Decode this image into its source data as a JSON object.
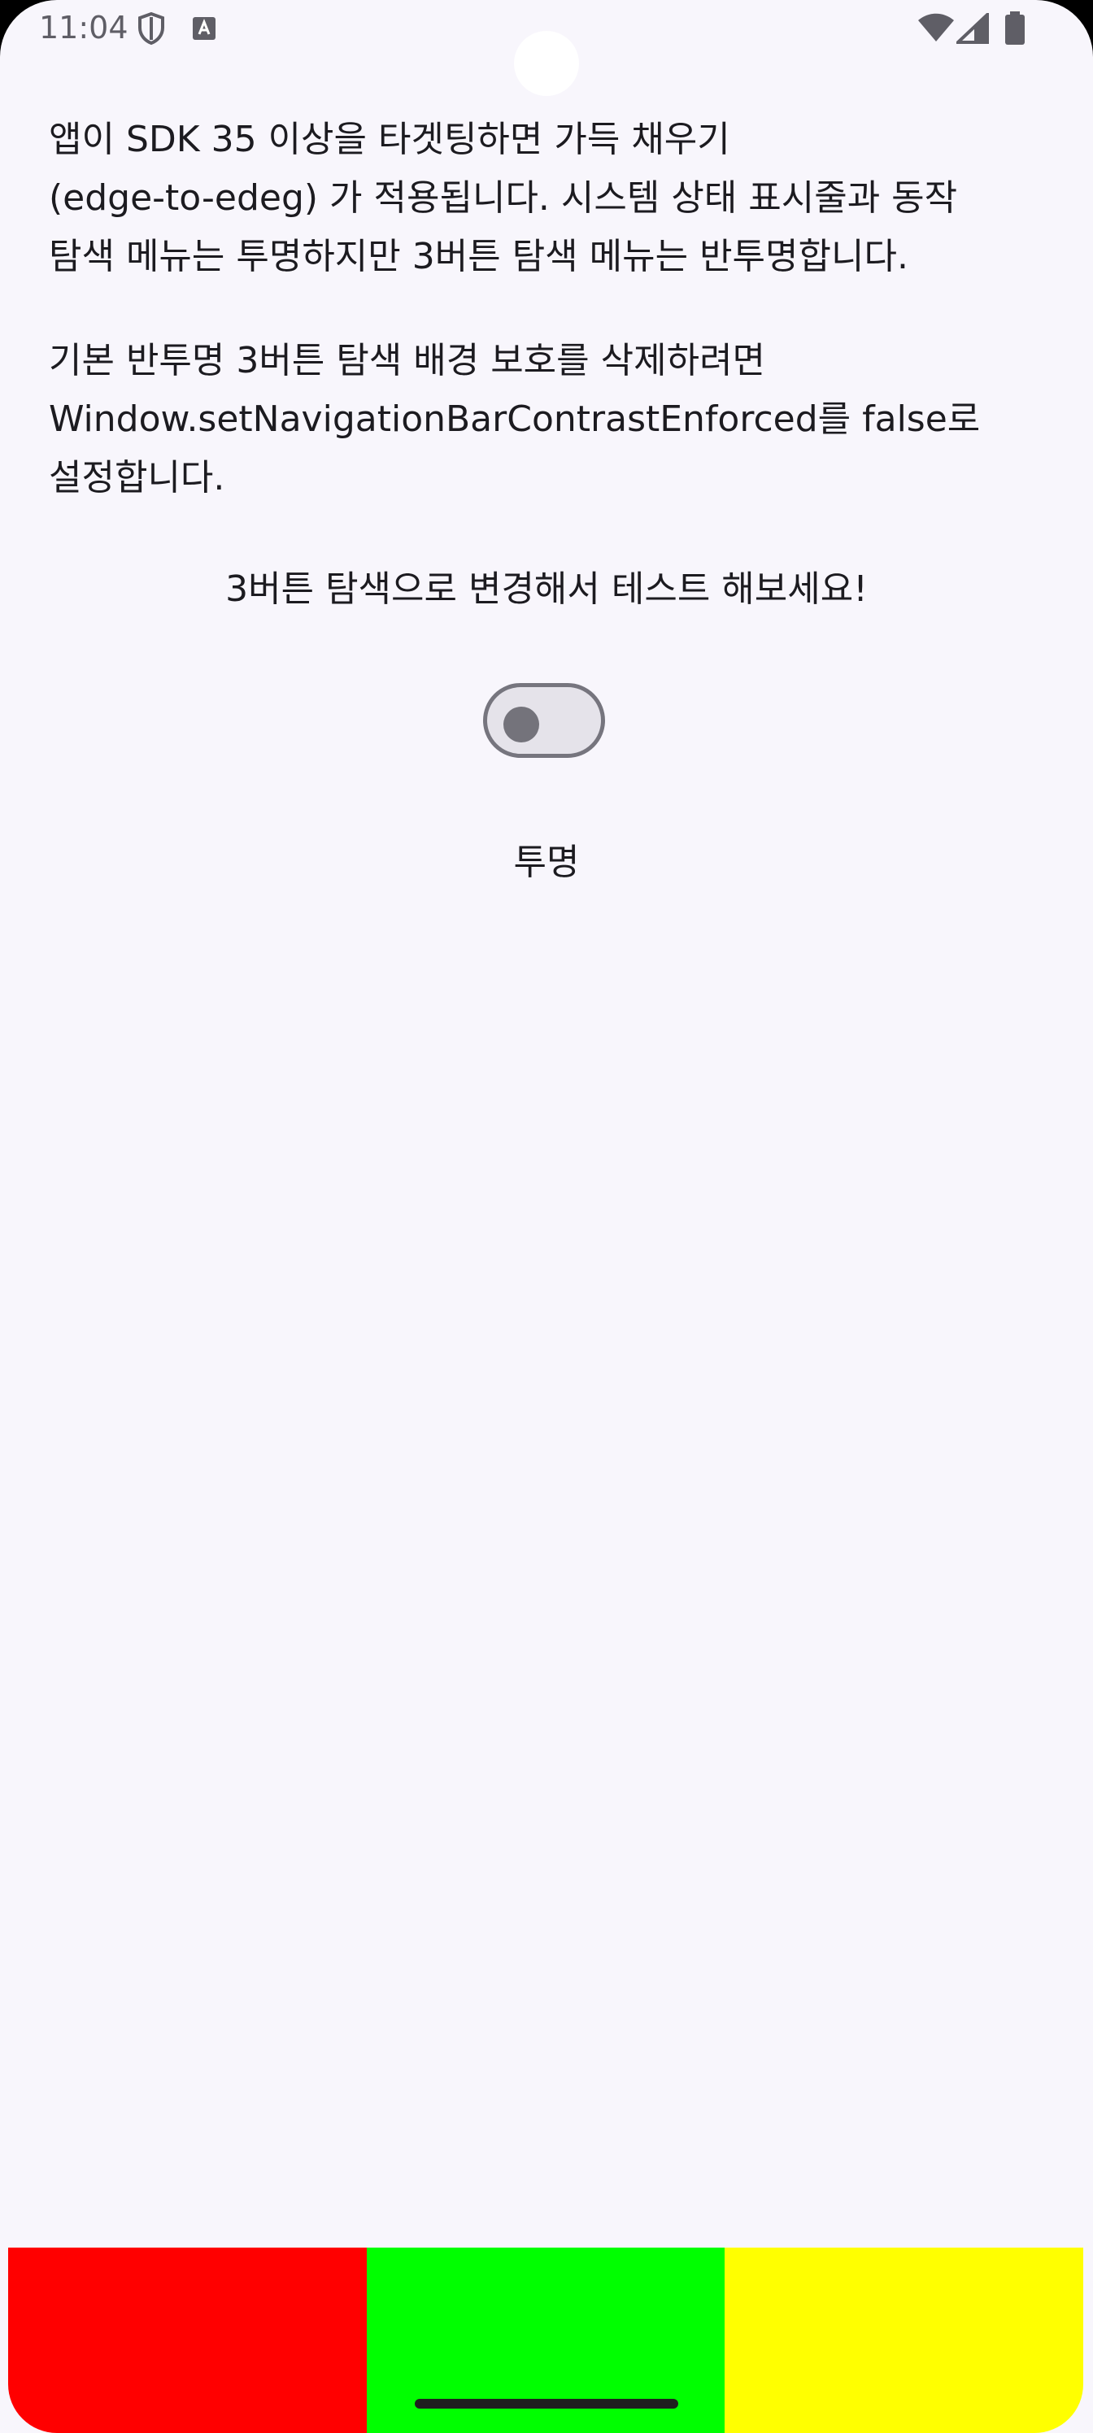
{
  "status_bar": {
    "time": "11:04",
    "icons": [
      "shield-icon",
      "keyboard-a-icon",
      "wifi-icon",
      "signal-icon",
      "battery-icon"
    ]
  },
  "content": {
    "paragraph1": "앱이 SDK 35 이상을 타겟팅하면 가득 채우기\n(edge-to-edeg) 가 적용됩니다. 시스템 상태 표시줄과 동작\n탐색 메뉴는 투명하지만 3버튼 탐색 메뉴는 반투명합니다.",
    "paragraph2": "기본 반투명 3버튼 탐색 배경 보호를 삭제하려면\nWindow.setNavigationBarContrastEnforced를 false로\n설정합니다.",
    "instruction": "3버튼 탐색으로 변경해서 테스트 해보세요!",
    "toggle": {
      "checked": false
    },
    "toggle_label": "투명"
  },
  "nav_bar_colors": [
    "#ff0000",
    "#00ff00",
    "#ffff00"
  ]
}
